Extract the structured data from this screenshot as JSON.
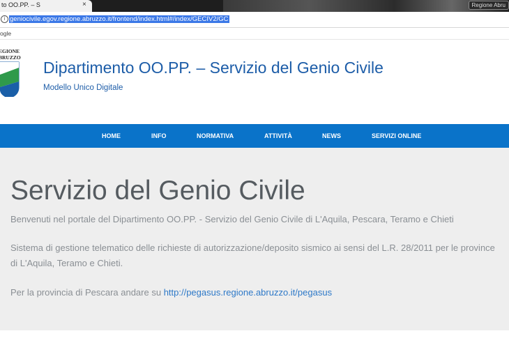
{
  "browser": {
    "tab_title": "to OO.PP. – S",
    "tab_close": "×",
    "extension_label": "Regione Abru",
    "url": "geniocivile.egov.regione.abruzzo.it/frontend/index.html#/index/GECIV2/GC",
    "info_icon": "ⓘ",
    "bookmark": "ogle"
  },
  "header": {
    "logo_text_1": "EGIONE",
    "logo_text_2": "BRUZZO",
    "title": "Dipartimento OO.PP. – Servizio del Genio Civile",
    "subtitle": "Modello Unico Digitale"
  },
  "nav": {
    "items": [
      {
        "label": "HOME"
      },
      {
        "label": "INFO"
      },
      {
        "label": "NORMATIVA"
      },
      {
        "label": "ATTIVITÀ"
      },
      {
        "label": "NEWS"
      },
      {
        "label": "SERVIZI ONLINE"
      }
    ]
  },
  "main": {
    "title": "Servizio del Genio Civile",
    "welcome": "Benvenuti nel portale del Dipartimento OO.PP. - Servizio del Genio Civile di L'Aquila, Pescara, Teramo e Chieti",
    "system_text": "Sistema di gestione telematico delle richieste di autorizzazione/deposito sismico ai sensi del L.R. 28/2011 per le province di L'Aquila, Teramo e Chieti.",
    "pescara_prefix": "Per la provincia di Pescara andare su ",
    "pescara_link": "http://pegasus.regione.abruzzo.it/pegasus"
  },
  "colors": {
    "brand_blue": "#1d5da8",
    "nav_blue": "#0a73c9",
    "link_blue": "#2e79c8",
    "logo_green": "#2f9a4b",
    "logo_blue": "#1a5fa8"
  },
  "icons": {
    "info": "info-icon",
    "close": "close-icon",
    "logo": "regione-abruzzo-logo"
  }
}
